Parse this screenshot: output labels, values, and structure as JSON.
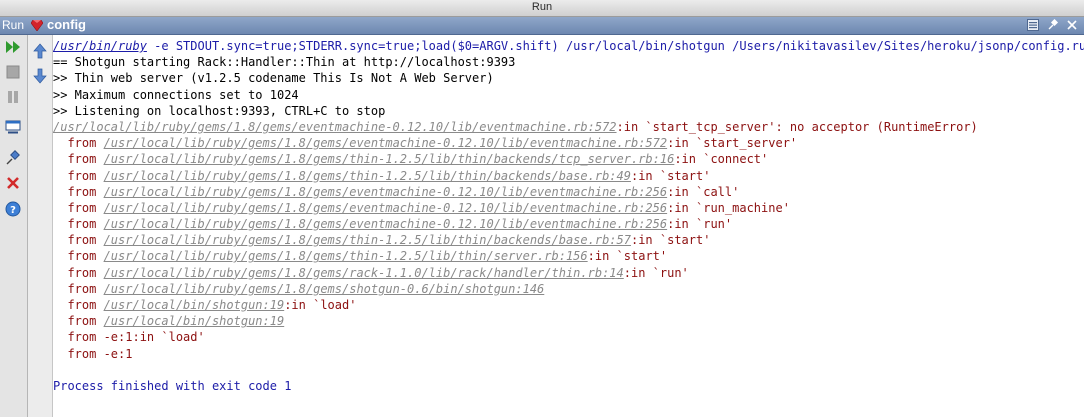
{
  "window": {
    "title": "Run"
  },
  "tab": {
    "run_label": "Run",
    "config_label": "config"
  },
  "icons": {
    "tab_ruby": "ruby-gem-icon",
    "tab_buttons": [
      "restore-icon",
      "pin-icon",
      "close-icon"
    ],
    "left": [
      "rerun-icon",
      "stop-icon",
      "pause-icon",
      "layout-icon",
      "pin-icon",
      "close-red-icon",
      "help-icon"
    ],
    "left2": [
      "scroll-up-icon",
      "scroll-down-icon"
    ]
  },
  "console": {
    "command": {
      "path": "/usr/bin/ruby",
      "args": " -e STDOUT.sync=true;STDERR.sync=true;load($0=ARGV.shift) /usr/local/bin/shotgun /Users/nikitavasilev/Sites/heroku/jsonp/config.ru"
    },
    "info": [
      "== Shotgun starting Rack::Handler::Thin at http://localhost:9393",
      ">> Thin web server (v1.2.5 codename This Is Not A Web Server)",
      ">> Maximum connections set to 1024",
      ">> Listening on localhost:9393, CTRL+C to stop"
    ],
    "error_head": {
      "path": "/usr/local/lib/ruby/gems/1.8/gems/eventmachine-0.12.10/lib/eventmachine.rb:572",
      "message": ":in `start_tcp_server': no acceptor (RuntimeError)"
    },
    "trace": [
      {
        "prefix": "  from ",
        "path": "/usr/local/lib/ruby/gems/1.8/gems/eventmachine-0.12.10/lib/eventmachine.rb:572",
        "suffix": ":in `start_server'"
      },
      {
        "prefix": "  from ",
        "path": "/usr/local/lib/ruby/gems/1.8/gems/thin-1.2.5/lib/thin/backends/tcp_server.rb:16",
        "suffix": ":in `connect'"
      },
      {
        "prefix": "  from ",
        "path": "/usr/local/lib/ruby/gems/1.8/gems/thin-1.2.5/lib/thin/backends/base.rb:49",
        "suffix": ":in `start'"
      },
      {
        "prefix": "  from ",
        "path": "/usr/local/lib/ruby/gems/1.8/gems/eventmachine-0.12.10/lib/eventmachine.rb:256",
        "suffix": ":in `call'"
      },
      {
        "prefix": "  from ",
        "path": "/usr/local/lib/ruby/gems/1.8/gems/eventmachine-0.12.10/lib/eventmachine.rb:256",
        "suffix": ":in `run_machine'"
      },
      {
        "prefix": "  from ",
        "path": "/usr/local/lib/ruby/gems/1.8/gems/eventmachine-0.12.10/lib/eventmachine.rb:256",
        "suffix": ":in `run'"
      },
      {
        "prefix": "  from ",
        "path": "/usr/local/lib/ruby/gems/1.8/gems/thin-1.2.5/lib/thin/backends/base.rb:57",
        "suffix": ":in `start'"
      },
      {
        "prefix": "  from ",
        "path": "/usr/local/lib/ruby/gems/1.8/gems/thin-1.2.5/lib/thin/server.rb:156",
        "suffix": ":in `start'"
      },
      {
        "prefix": "  from ",
        "path": "/usr/local/lib/ruby/gems/1.8/gems/rack-1.1.0/lib/rack/handler/thin.rb:14",
        "suffix": ":in `run'"
      },
      {
        "prefix": "  from ",
        "path": "/usr/local/lib/ruby/gems/1.8/gems/shotgun-0.6/bin/shotgun:146",
        "suffix": ""
      },
      {
        "prefix": "  from ",
        "path": "/usr/local/bin/shotgun:19",
        "suffix": ":in `load'"
      },
      {
        "prefix": "  from ",
        "path": "/usr/local/bin/shotgun:19",
        "suffix": ""
      },
      {
        "prefix": "  from ",
        "path": "",
        "suffix": "-e:1:in `load'"
      },
      {
        "prefix": "  from ",
        "path": "",
        "suffix": "-e:1"
      }
    ],
    "exit_message": "Process finished with exit code 1"
  },
  "colors": {
    "tab_blue": "#6d87b0",
    "command_blue": "#1c1ca8",
    "error_red": "#8c1010",
    "link_gray": "#8a8a8a"
  }
}
